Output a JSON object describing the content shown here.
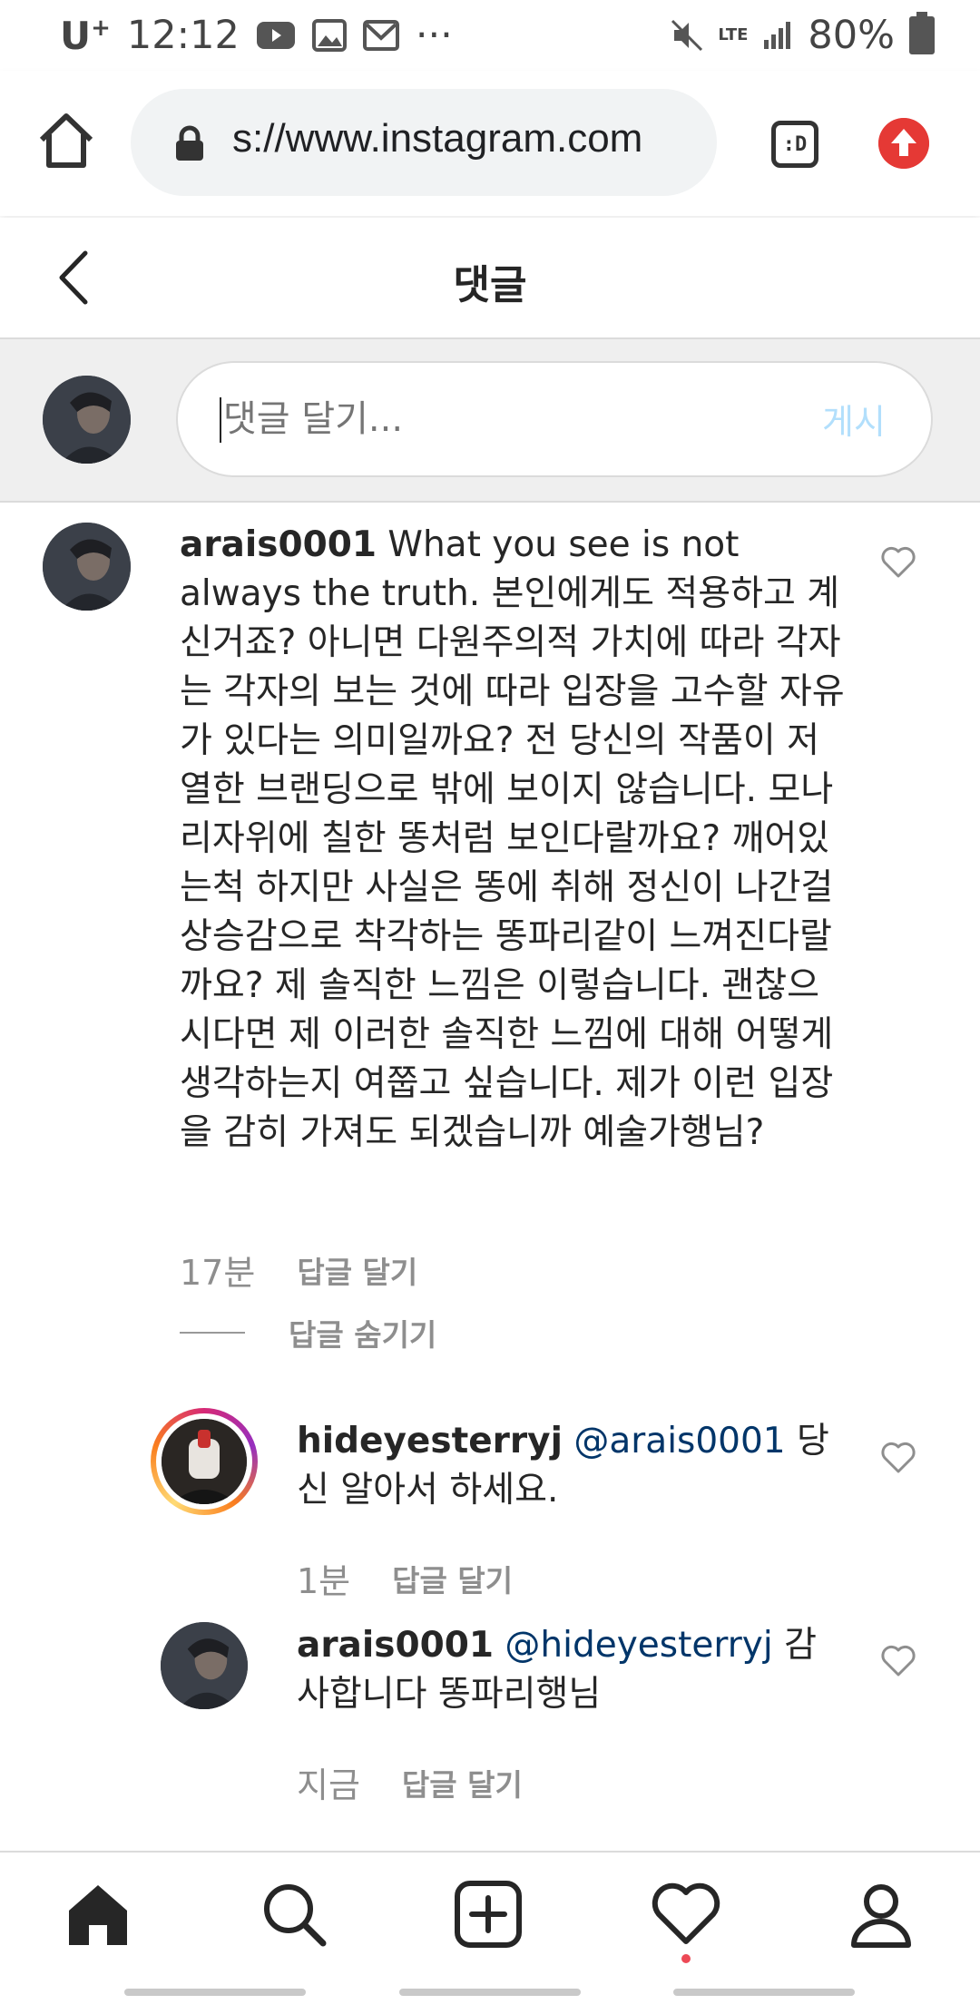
{
  "status_bar": {
    "carrier": "U",
    "time": "12:12",
    "more": "···",
    "battery": "80%",
    "network": "LTE"
  },
  "browser": {
    "url": "s://www.instagram.com",
    "tabs_label": ":D"
  },
  "header": {
    "title": "댓글"
  },
  "composer": {
    "placeholder": "댓글 달기...",
    "post_label": "게시"
  },
  "comments": [
    {
      "username": "arais0001",
      "text": "What you see is not always the truth. 본인에게도 적용하고 계신거죠? 아니면 다원주의적 가치에 따라 각자는 각자의 보는 것에 따라 입장을 고수할 자유가 있다는 의미일까요? 전 당신의 작품이 저열한 브랜딩으로 밖에 보이지 않습니다. 모나리자위에 칠한 똥처럼 보인다랄까요? 깨어있는척 하지만 사실은 똥에 취해 정신이 나간걸 상승감으로 착각하는 똥파리같이 느껴진다랄까요? 제 솔직한 느낌은 이렇습니다. 괜찮으시다면 제 이러한 솔직한 느낌에 대해 어떻게 생각하는지 여쭙고 싶습니다. 제가 이런 입장을 감히 가져도 되겠습니까 예술가행님?",
      "time": "17분",
      "reply_label": "답글 달기",
      "hide_replies_label": "답글 숨기기"
    },
    {
      "username": "hideyesterryj",
      "mention": "@arais0001",
      "text": "당신 알아서 하세요.",
      "time": "1분",
      "reply_label": "답글 달기"
    },
    {
      "username": "arais0001",
      "mention": "@hideyesterryj",
      "text": "감사합니다 똥파리행님",
      "time": "지금",
      "reply_label": "답글 달기"
    }
  ],
  "bottom_nav": {
    "items": [
      "home-icon",
      "search-icon",
      "add-post-icon",
      "activity-heart-icon",
      "profile-icon"
    ]
  },
  "colors": {
    "text": "#262626",
    "muted": "#8e8e8e",
    "mention": "#003569",
    "post_disabled": "#b2dffc",
    "notification_dot": "#ed4956"
  }
}
